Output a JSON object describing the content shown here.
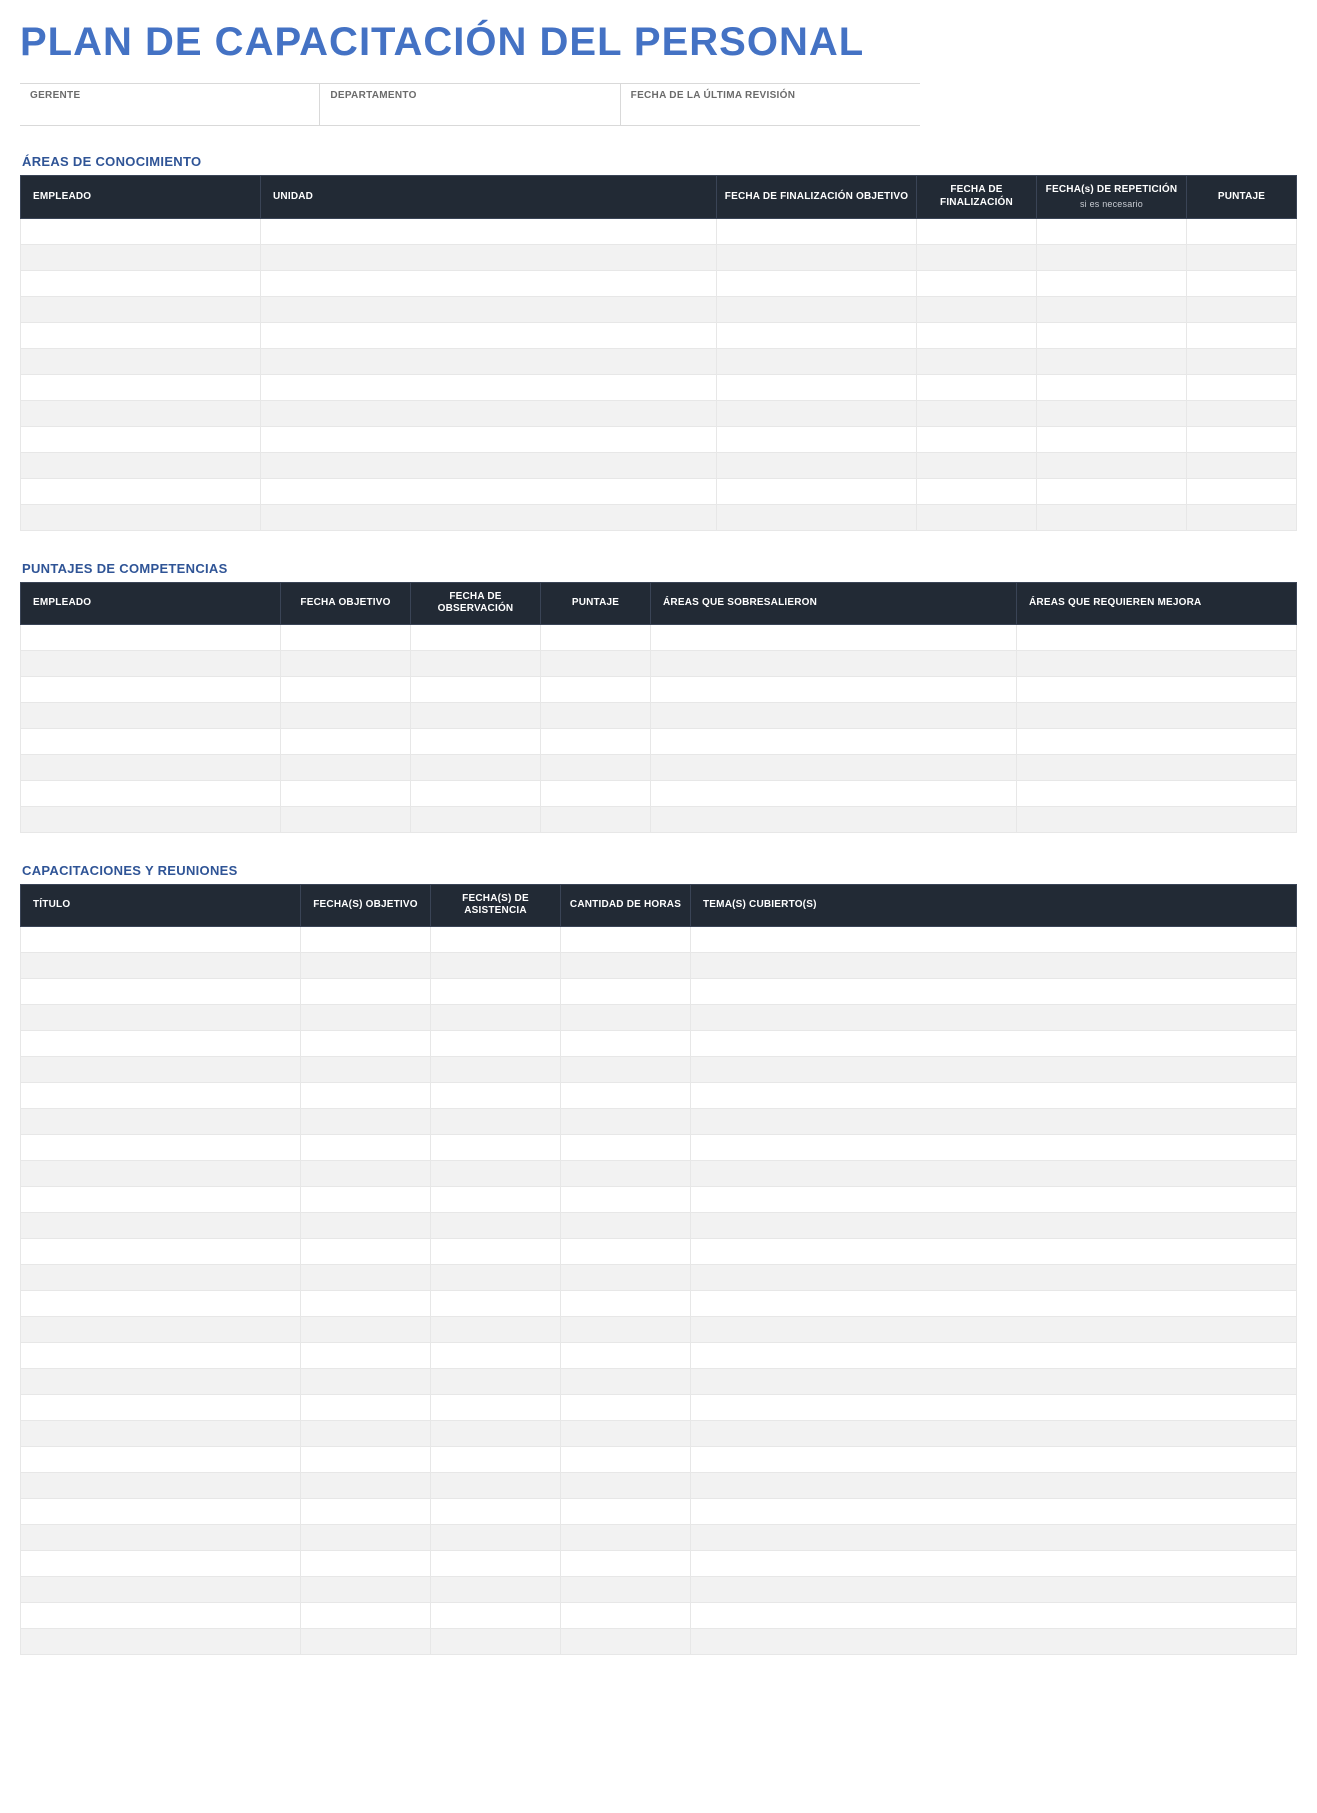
{
  "title": "PLAN DE CAPACITACIÓN DEL PERSONAL",
  "meta": {
    "gerente_label": "GERENTE",
    "gerente_value": "",
    "departamento_label": "DEPARTAMENTO",
    "departamento_value": "",
    "fecha_rev_label": "FECHA DE LA ÚLTIMA REVISIÓN",
    "fecha_rev_value": ""
  },
  "section1": {
    "heading": "ÁREAS DE CONOCIMIENTO",
    "cols": {
      "empleado": "EMPLEADO",
      "unidad": "UNIDAD",
      "fecha_fin_obj": "FECHA DE FINALIZACIÓN OBJETIVO",
      "fecha_fin": "FECHA DE FINALIZACIÓN",
      "fechas_rep": "FECHA(s) DE REPETICIÓN",
      "fechas_rep_sub": "si es necesario",
      "puntaje": "PUNTAJE"
    },
    "rows": [
      {
        "empleado": "",
        "unidad": "",
        "fecha_fin_obj": "",
        "fecha_fin": "",
        "fechas_rep": "",
        "puntaje": ""
      },
      {
        "empleado": "",
        "unidad": "",
        "fecha_fin_obj": "",
        "fecha_fin": "",
        "fechas_rep": "",
        "puntaje": ""
      },
      {
        "empleado": "",
        "unidad": "",
        "fecha_fin_obj": "",
        "fecha_fin": "",
        "fechas_rep": "",
        "puntaje": ""
      },
      {
        "empleado": "",
        "unidad": "",
        "fecha_fin_obj": "",
        "fecha_fin": "",
        "fechas_rep": "",
        "puntaje": ""
      },
      {
        "empleado": "",
        "unidad": "",
        "fecha_fin_obj": "",
        "fecha_fin": "",
        "fechas_rep": "",
        "puntaje": ""
      },
      {
        "empleado": "",
        "unidad": "",
        "fecha_fin_obj": "",
        "fecha_fin": "",
        "fechas_rep": "",
        "puntaje": ""
      },
      {
        "empleado": "",
        "unidad": "",
        "fecha_fin_obj": "",
        "fecha_fin": "",
        "fechas_rep": "",
        "puntaje": ""
      },
      {
        "empleado": "",
        "unidad": "",
        "fecha_fin_obj": "",
        "fecha_fin": "",
        "fechas_rep": "",
        "puntaje": ""
      },
      {
        "empleado": "",
        "unidad": "",
        "fecha_fin_obj": "",
        "fecha_fin": "",
        "fechas_rep": "",
        "puntaje": ""
      },
      {
        "empleado": "",
        "unidad": "",
        "fecha_fin_obj": "",
        "fecha_fin": "",
        "fechas_rep": "",
        "puntaje": ""
      },
      {
        "empleado": "",
        "unidad": "",
        "fecha_fin_obj": "",
        "fecha_fin": "",
        "fechas_rep": "",
        "puntaje": ""
      },
      {
        "empleado": "",
        "unidad": "",
        "fecha_fin_obj": "",
        "fecha_fin": "",
        "fechas_rep": "",
        "puntaje": ""
      }
    ]
  },
  "section2": {
    "heading": "PUNTAJES DE COMPETENCIAS",
    "cols": {
      "empleado": "EMPLEADO",
      "fecha_obj": "FECHA OBJETIVO",
      "fecha_obs": "FECHA DE OBSERVACIÓN",
      "puntaje": "PUNTAJE",
      "areas_sobre": "ÁREAS QUE SOBRESALIERON",
      "areas_mejora": "ÁREAS QUE REQUIEREN MEJORA"
    },
    "rows": [
      {
        "empleado": "",
        "fecha_obj": "",
        "fecha_obs": "",
        "puntaje": "",
        "areas_sobre": "",
        "areas_mejora": ""
      },
      {
        "empleado": "",
        "fecha_obj": "",
        "fecha_obs": "",
        "puntaje": "",
        "areas_sobre": "",
        "areas_mejora": ""
      },
      {
        "empleado": "",
        "fecha_obj": "",
        "fecha_obs": "",
        "puntaje": "",
        "areas_sobre": "",
        "areas_mejora": ""
      },
      {
        "empleado": "",
        "fecha_obj": "",
        "fecha_obs": "",
        "puntaje": "",
        "areas_sobre": "",
        "areas_mejora": ""
      },
      {
        "empleado": "",
        "fecha_obj": "",
        "fecha_obs": "",
        "puntaje": "",
        "areas_sobre": "",
        "areas_mejora": ""
      },
      {
        "empleado": "",
        "fecha_obj": "",
        "fecha_obs": "",
        "puntaje": "",
        "areas_sobre": "",
        "areas_mejora": ""
      },
      {
        "empleado": "",
        "fecha_obj": "",
        "fecha_obs": "",
        "puntaje": "",
        "areas_sobre": "",
        "areas_mejora": ""
      },
      {
        "empleado": "",
        "fecha_obj": "",
        "fecha_obs": "",
        "puntaje": "",
        "areas_sobre": "",
        "areas_mejora": ""
      }
    ]
  },
  "section3": {
    "heading": "CAPACITACIONES Y REUNIONES",
    "cols": {
      "titulo": "TÍTULO",
      "fechas_obj": "FECHA(S) OBJETIVO",
      "fechas_asis": "FECHA(S) DE ASISTENCIA",
      "cant_horas": "CANTIDAD DE HORAS",
      "temas": "TEMA(S) CUBIERTO(S)"
    },
    "rows": [
      {
        "titulo": "",
        "fechas_obj": "",
        "fechas_asis": "",
        "cant_horas": "",
        "temas": ""
      },
      {
        "titulo": "",
        "fechas_obj": "",
        "fechas_asis": "",
        "cant_horas": "",
        "temas": ""
      },
      {
        "titulo": "",
        "fechas_obj": "",
        "fechas_asis": "",
        "cant_horas": "",
        "temas": ""
      },
      {
        "titulo": "",
        "fechas_obj": "",
        "fechas_asis": "",
        "cant_horas": "",
        "temas": ""
      },
      {
        "titulo": "",
        "fechas_obj": "",
        "fechas_asis": "",
        "cant_horas": "",
        "temas": ""
      },
      {
        "titulo": "",
        "fechas_obj": "",
        "fechas_asis": "",
        "cant_horas": "",
        "temas": ""
      },
      {
        "titulo": "",
        "fechas_obj": "",
        "fechas_asis": "",
        "cant_horas": "",
        "temas": ""
      },
      {
        "titulo": "",
        "fechas_obj": "",
        "fechas_asis": "",
        "cant_horas": "",
        "temas": ""
      },
      {
        "titulo": "",
        "fechas_obj": "",
        "fechas_asis": "",
        "cant_horas": "",
        "temas": ""
      },
      {
        "titulo": "",
        "fechas_obj": "",
        "fechas_asis": "",
        "cant_horas": "",
        "temas": ""
      },
      {
        "titulo": "",
        "fechas_obj": "",
        "fechas_asis": "",
        "cant_horas": "",
        "temas": ""
      },
      {
        "titulo": "",
        "fechas_obj": "",
        "fechas_asis": "",
        "cant_horas": "",
        "temas": ""
      },
      {
        "titulo": "",
        "fechas_obj": "",
        "fechas_asis": "",
        "cant_horas": "",
        "temas": ""
      },
      {
        "titulo": "",
        "fechas_obj": "",
        "fechas_asis": "",
        "cant_horas": "",
        "temas": ""
      },
      {
        "titulo": "",
        "fechas_obj": "",
        "fechas_asis": "",
        "cant_horas": "",
        "temas": ""
      },
      {
        "titulo": "",
        "fechas_obj": "",
        "fechas_asis": "",
        "cant_horas": "",
        "temas": ""
      },
      {
        "titulo": "",
        "fechas_obj": "",
        "fechas_asis": "",
        "cant_horas": "",
        "temas": ""
      },
      {
        "titulo": "",
        "fechas_obj": "",
        "fechas_asis": "",
        "cant_horas": "",
        "temas": ""
      },
      {
        "titulo": "",
        "fechas_obj": "",
        "fechas_asis": "",
        "cant_horas": "",
        "temas": ""
      },
      {
        "titulo": "",
        "fechas_obj": "",
        "fechas_asis": "",
        "cant_horas": "",
        "temas": ""
      },
      {
        "titulo": "",
        "fechas_obj": "",
        "fechas_asis": "",
        "cant_horas": "",
        "temas": ""
      },
      {
        "titulo": "",
        "fechas_obj": "",
        "fechas_asis": "",
        "cant_horas": "",
        "temas": ""
      },
      {
        "titulo": "",
        "fechas_obj": "",
        "fechas_asis": "",
        "cant_horas": "",
        "temas": ""
      },
      {
        "titulo": "",
        "fechas_obj": "",
        "fechas_asis": "",
        "cant_horas": "",
        "temas": ""
      },
      {
        "titulo": "",
        "fechas_obj": "",
        "fechas_asis": "",
        "cant_horas": "",
        "temas": ""
      },
      {
        "titulo": "",
        "fechas_obj": "",
        "fechas_asis": "",
        "cant_horas": "",
        "temas": ""
      },
      {
        "titulo": "",
        "fechas_obj": "",
        "fechas_asis": "",
        "cant_horas": "",
        "temas": ""
      },
      {
        "titulo": "",
        "fechas_obj": "",
        "fechas_asis": "",
        "cant_horas": "",
        "temas": ""
      }
    ]
  }
}
